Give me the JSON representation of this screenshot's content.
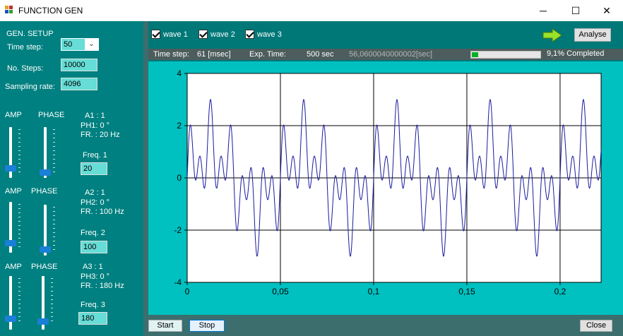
{
  "window": {
    "title": "FUNCTION GEN",
    "minimize_glyph": "─",
    "maximize_glyph": "☐",
    "close_glyph": "✕"
  },
  "gen_setup": {
    "heading": "GEN. SETUP",
    "time_step_label": "Time step:",
    "time_step_value": "50",
    "no_steps_label": "No. Steps:",
    "no_steps_value": "10000",
    "sampling_rate_label": "Sampling rate:",
    "sampling_rate_value": "4096"
  },
  "channels": [
    {
      "amp_label": "AMP",
      "phase_label": "PHASE",
      "a_label": "A1 : 1",
      "ph_label": "PH1: 0 °",
      "fr_label": "FR. : 20 Hz",
      "freq_label": "Freq. 1",
      "freq_value": "20",
      "amp_level": 0.0,
      "phase_level": 0.0
    },
    {
      "amp_label": "AMP",
      "phase_label": "PHASE",
      "a_label": "A2 : 1",
      "ph_label": "PH2: 0 °",
      "fr_label": "FR. : 100 Hz",
      "freq_label": "Freq. 2",
      "freq_value": "100",
      "amp_level": 0.0,
      "phase_level": 0.0
    },
    {
      "amp_label": "AMP",
      "phase_label": "PHASE",
      "a_label": "A3 : 1",
      "ph_label": "PH3: 0 °",
      "fr_label": "FR. : 180 Hz",
      "freq_label": "Freq. 3",
      "freq_value": "180",
      "amp_level": 0.0,
      "phase_level": 0.0
    }
  ],
  "toolbar": {
    "wave1_label": "wave 1",
    "wave2_label": "wave 2",
    "wave3_label": "wave 3",
    "wave1_checked": true,
    "wave2_checked": true,
    "wave3_checked": true,
    "arrow_icon": "right-arrow-icon",
    "analyse_label": "Analyse"
  },
  "status": {
    "time_step_label": "Time step:",
    "time_step_value": "61 [msec]",
    "exp_time_label": "Exp. Time:",
    "exp_time_value": "500 sec",
    "elapsed_value": "56,0600040000002[sec]",
    "progress_fraction": 0.091,
    "progress_label": "9,1% Completed"
  },
  "buttons": {
    "start_label": "Start",
    "stop_label": "Stop",
    "close_label": "Close"
  },
  "colors": {
    "panel_bg": "#008080",
    "plot_bg": "#ffffff",
    "chart_area_bg": "#00c0c0",
    "trace": "#1a1aa0",
    "progress": "#06b025",
    "slider_thumb": "#1a7fd6"
  },
  "chart_data": {
    "type": "line",
    "title": "",
    "xlabel": "",
    "ylabel": "",
    "xlim": [
      0,
      0.222
    ],
    "ylim": [
      -4,
      4
    ],
    "x_ticks": [
      0,
      0.05,
      0.1,
      0.15,
      0.2
    ],
    "x_tick_labels": [
      "0",
      "0,05",
      "0,1",
      "0,15",
      "0,2"
    ],
    "y_ticks": [
      4,
      2,
      0,
      -2,
      -4
    ],
    "y_tick_labels": [
      "4",
      "2",
      "0",
      "-2",
      "-4"
    ],
    "grid": true,
    "series": [
      {
        "formula": "sin(2π·20·t) + sin(2π·100·t) + sin(2π·180·t)",
        "frequencies_hz": [
          20,
          100,
          180
        ],
        "amplitudes": [
          1,
          1,
          1
        ],
        "phases_deg": [
          0,
          0,
          0
        ],
        "t_start": 0,
        "t_end": 0.222,
        "y_max_observed": 3.0,
        "y_min_observed": -3.0
      }
    ]
  }
}
